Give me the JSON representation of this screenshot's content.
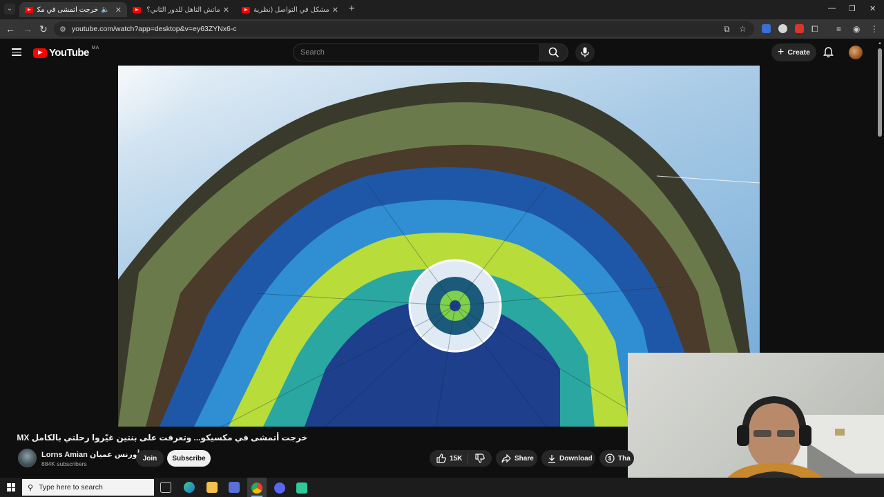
{
  "browser": {
    "tabs": [
      {
        "title": "خرجت أتمشى في مكسيكو...",
        "active": true
      },
      {
        "title": "ماتش التأهل للدور الثاني؟ (التشكا",
        "active": false
      },
      {
        "title": "مشكل في التواصل (نظرية الزراك",
        "active": false
      }
    ],
    "new_tab": "+",
    "window_controls": {
      "minimize": "—",
      "restore": "❐",
      "close": "✕"
    },
    "url": "youtube.com/watch?app=desktop&v=ey63ZYNx6-c"
  },
  "youtube": {
    "logo_text": "YouTube",
    "country_code": "MA",
    "search_placeholder": "Search",
    "create_label": "Create"
  },
  "video": {
    "title": "خرجت أتمشى في مكسيكو... وتعرفت على بنتين غيّروا رحلتي بالكامل MX",
    "channel_name": "Lorns Amian أورنس عميان",
    "subscribers": "884K subscribers",
    "join_label": "Join",
    "subscribe_label": "Subscribe",
    "likes": "15K",
    "share_label": "Share",
    "download_label": "Download",
    "thanks_label": "Tha"
  },
  "taskbar": {
    "search_placeholder": "Type here to search"
  },
  "colors": {
    "yt_red": "#ff0000",
    "background": "#0f0f0f",
    "pill": "#272727",
    "accent_blue": "#7eb4ea"
  }
}
